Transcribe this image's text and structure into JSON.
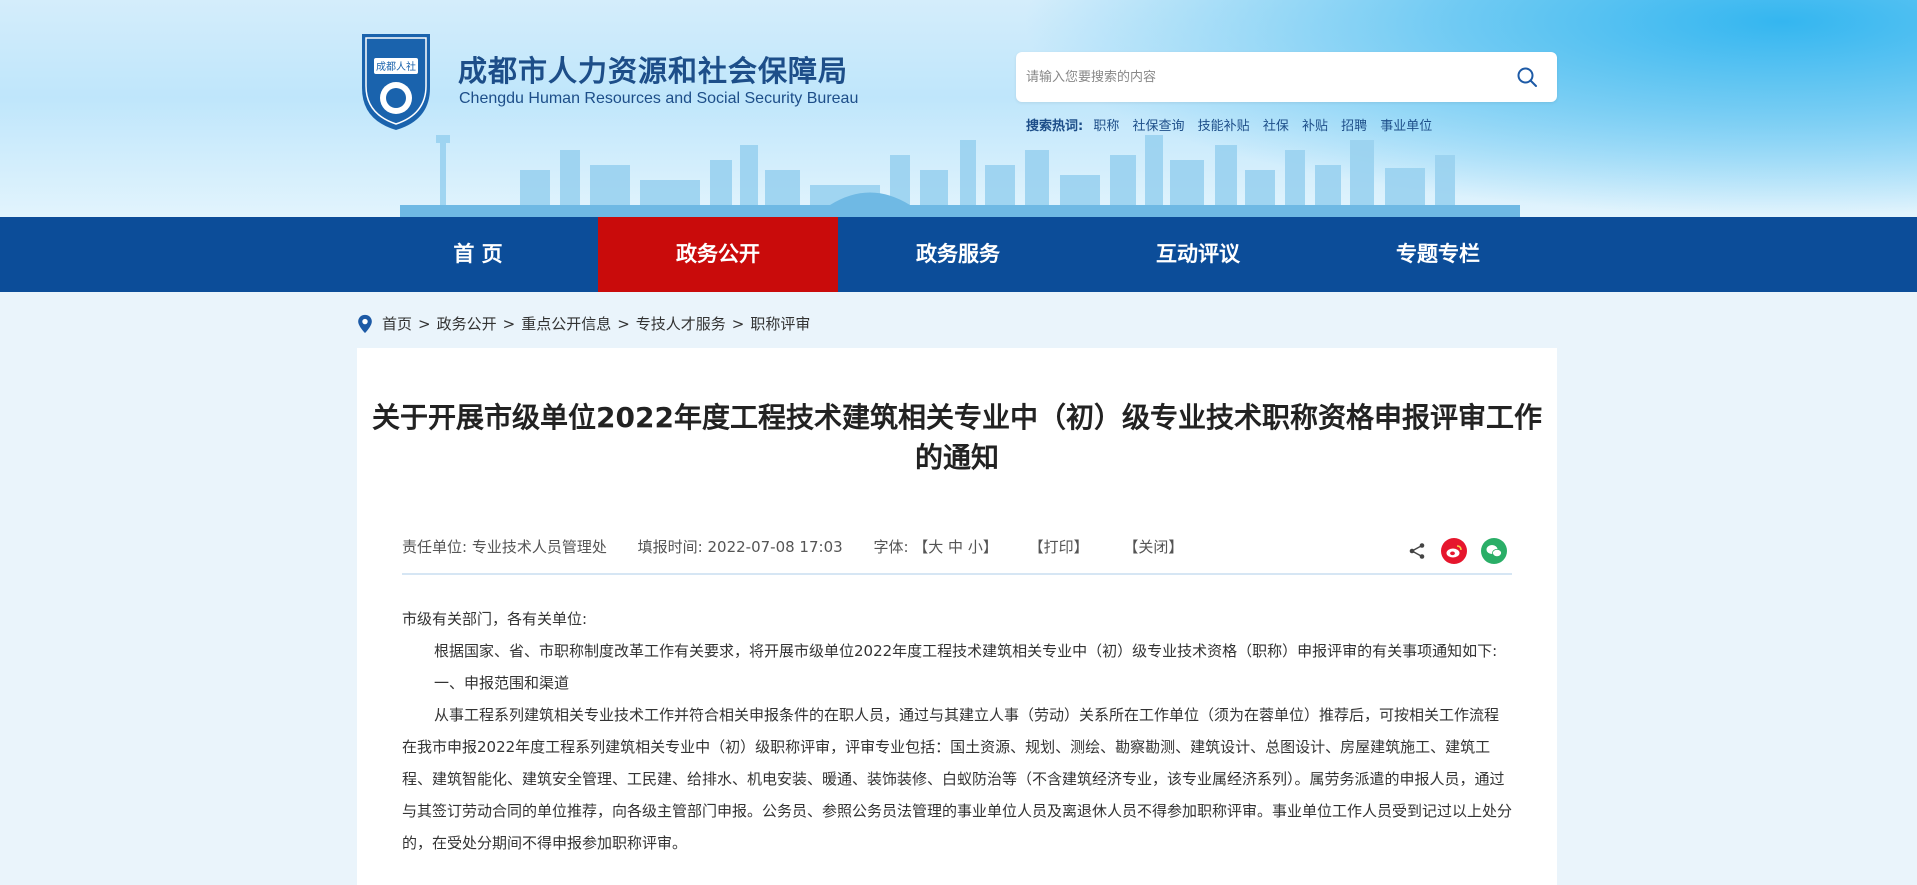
{
  "header": {
    "logo_text": "成都人社",
    "title_cn": "成都市人力资源和社会保障局",
    "title_en": "Chengdu Human Resources and Social Security Bureau",
    "search": {
      "placeholder": "请输入您要搜索的内容"
    },
    "hot_label": "搜索热词:",
    "hot_words": [
      "职称",
      "社保查询",
      "技能补贴",
      "社保",
      "补贴",
      "招聘",
      "事业单位"
    ]
  },
  "nav": {
    "items": [
      {
        "label": "首  页",
        "active": false
      },
      {
        "label": "政务公开",
        "active": true
      },
      {
        "label": "政务服务",
        "active": false
      },
      {
        "label": "互动评议",
        "active": false
      },
      {
        "label": "专题专栏",
        "active": false
      }
    ]
  },
  "breadcrumb": {
    "items": [
      "首页",
      "政务公开",
      "重点公开信息",
      "专技人才服务",
      "职称评审"
    ],
    "separator": ">"
  },
  "article": {
    "title": "关于开展市级单位2022年度工程技术建筑相关专业中（初）级专业技术职称资格申报评审工作的通知",
    "meta": {
      "dept_label": "责任单位:",
      "dept_value": "专业技术人员管理处",
      "time_label": "填报时间:",
      "time_value": "2022-07-08 17:03",
      "font_label": "字体:",
      "font_options": "【大 中 小】",
      "print": "【打印】",
      "close": "【关闭】"
    },
    "share_icons": [
      "share-icon",
      "weibo-icon",
      "wechat-icon"
    ],
    "paragraphs": [
      "市级有关部门，各有关单位:",
      "根据国家、省、市职称制度改革工作有关要求，将开展市级单位2022年度工程技术建筑相关专业中（初）级专业技术资格（职称）申报评审的有关事项通知如下:",
      "一、申报范围和渠道",
      "从事工程系列建筑相关专业技术工作并符合相关申报条件的在职人员，通过与其建立人事（劳动）关系所在工作单位（须为在蓉单位）推荐后，可按相关工作流程在我市申报2022年度工程系列建筑相关专业中（初）级职称评审，评审专业包括：国土资源、规划、测绘、勘察勘测、建筑设计、总图设计、房屋建筑施工、建筑工程、建筑智能化、建筑安全管理、工民建、给排水、机电安装、暖通、装饰装修、白蚁防治等（不含建筑经济专业，该专业属经济系列）。属劳务派遣的申报人员，通过与其签订劳动合同的单位推荐，向各级主管部门申报。公务员、参照公务员法管理的事业单位人员及离退休人员不得参加职称评审。事业单位工作人员受到记过以上处分的，在受处分期间不得申报参加职称评审。"
    ]
  },
  "colors": {
    "nav_bg": "#0c4d99",
    "nav_active": "#c90b0b",
    "brand_text": "#1d4e89",
    "weibo": "#e6162d",
    "wechat": "#2aae67"
  }
}
